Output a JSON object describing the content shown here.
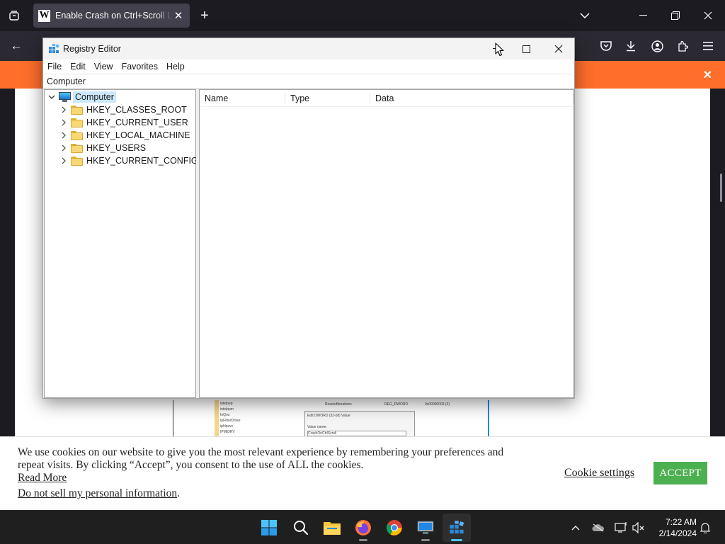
{
  "browser": {
    "tab_title": "Enable Crash on Ctrl+Scroll Lock",
    "tab_favicon_letter": "W",
    "tab_close": "✕",
    "newtab": "+",
    "list_all_tabs": "⌄",
    "minimize": "—",
    "restore": "❐",
    "close": "✕",
    "back": "←",
    "forward": "→"
  },
  "regedit": {
    "title": "Registry Editor",
    "menu": [
      "File",
      "Edit",
      "View",
      "Favorites",
      "Help"
    ],
    "address": "Computer",
    "tree_root": "Computer",
    "hives": [
      "HKEY_CLASSES_ROOT",
      "HKEY_CURRENT_USER",
      "HKEY_LOCAL_MACHINE",
      "HKEY_USERS",
      "HKEY_CURRENT_CONFIG"
    ],
    "columns": [
      "Name",
      "Type",
      "Data"
    ],
    "minimize": "—",
    "maximize": "☐",
    "close": "✕"
  },
  "article_image": {
    "tree_items": [
      "intelpep",
      "intelppm",
      "IoQos",
      "IpFilterDriver",
      "iphlpsvc",
      "IPMIDRV"
    ],
    "value_name": "ResendIterations",
    "value_type": "REG_DWORD",
    "value_data": "0x00000003 (3)",
    "dialog_title": "Edit DWORD (32-bit) Value",
    "dialog_field_label": "Value name:",
    "dialog_field_value": "CrashOnCtrlScroll"
  },
  "cookie": {
    "text": "We use cookies on our website to give you the most relevant experience by remembering your preferences and repeat visits. By clicking “Accept”, you consent to the use of ALL the cookies.",
    "read_more": "Read More",
    "do_not_sell": "Do not sell my personal information",
    "do_not_sell_suffix": ".",
    "settings": "Cookie settings",
    "accept": "ACCEPT"
  },
  "taskbar": {
    "apps": [
      "start-icon",
      "search-icon",
      "file-explorer-icon",
      "firefox-icon",
      "chrome-icon",
      "remote-desktop-icon",
      "registry-editor-icon"
    ],
    "time": "7:22 AM",
    "date": "2/14/2024"
  },
  "colors": {
    "notification_bar": "#ff6e2b",
    "accept_button": "#4caf50",
    "selection": "#cce8ff",
    "taskbar_active": "#4cc2ff"
  }
}
